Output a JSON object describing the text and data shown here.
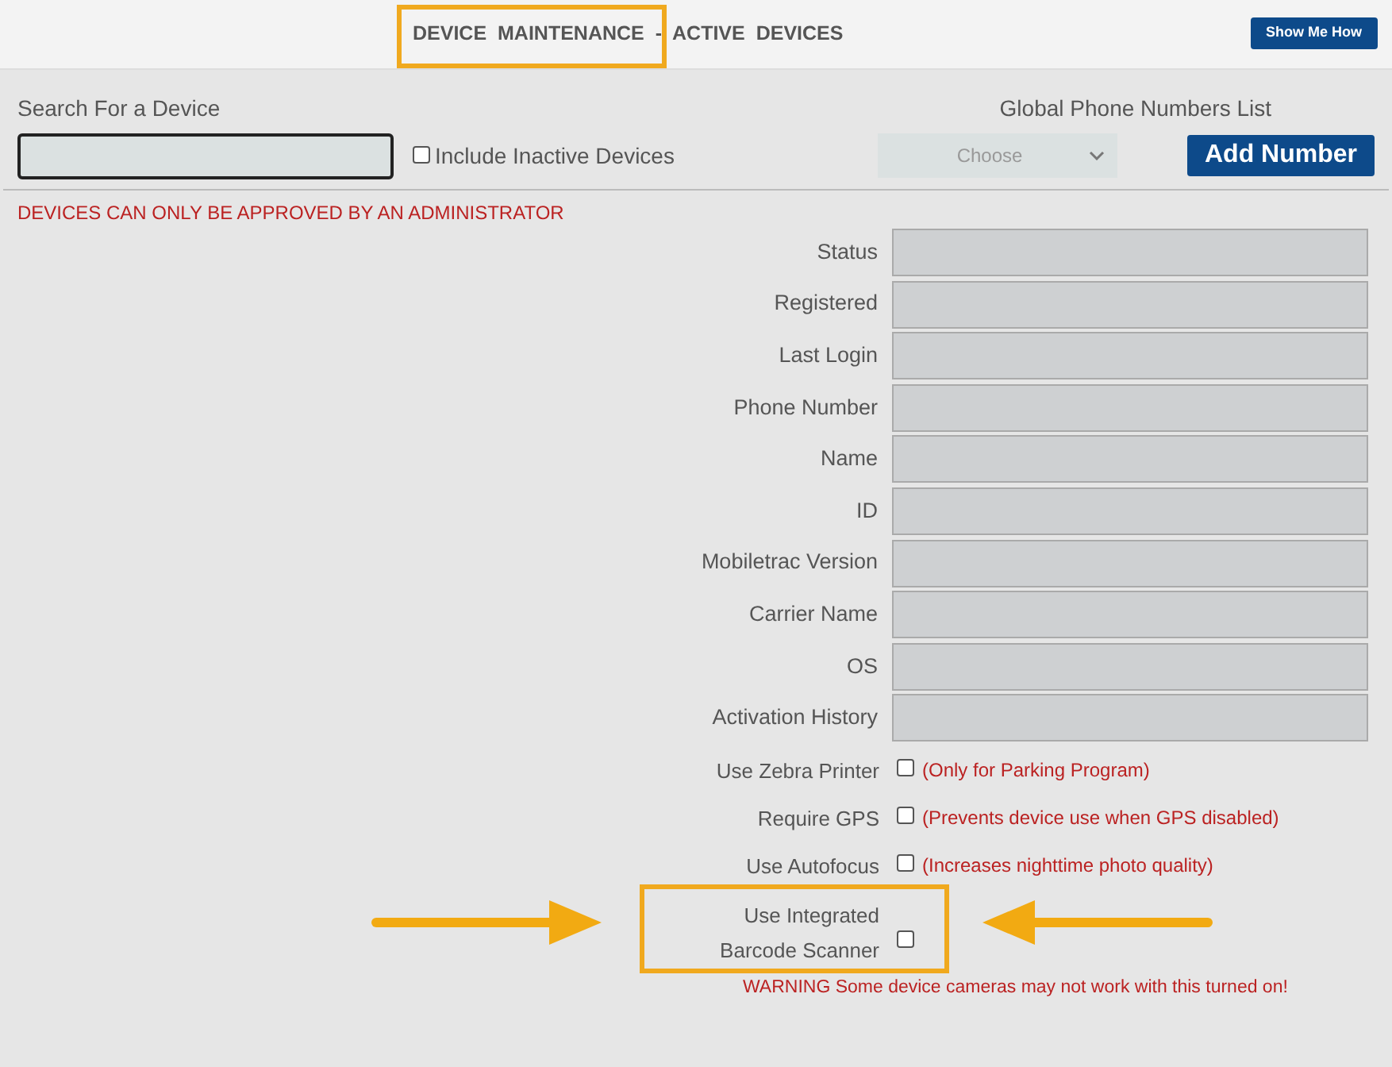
{
  "header": {
    "title": "DEVICE MAINTENANCE - ACTIVE DEVICES",
    "help_button": "Show Me How"
  },
  "search": {
    "label": "Search For a Device",
    "include_inactive": {
      "label": "Include Inactive Devices",
      "checked": false
    }
  },
  "global_phone": {
    "label": "Global Phone Numbers List",
    "select": "Choose",
    "add_button": "Add Number"
  },
  "notice": "DEVICES CAN ONLY BE APPROVED BY AN ADMINISTRATOR",
  "fields": [
    "Status",
    "Registered",
    "Last Login",
    "Phone Number",
    "Name",
    "ID",
    "Mobiletrac Version",
    "Carrier Name",
    "OS",
    "Activation History"
  ],
  "options": [
    {
      "kind": "inline",
      "label": "Use Zebra Printer",
      "checked": false,
      "note": "(Only for Parking Program)"
    },
    {
      "kind": "inline",
      "label": "Require GPS",
      "checked": false,
      "note": "(Prevents device use when GPS disabled)"
    },
    {
      "kind": "inline",
      "label": "Use Autofocus",
      "checked": false,
      "note": "(Increases nighttime photo quality)"
    },
    {
      "kind": "stacked",
      "label": "Use Integrated Barcode Scanner",
      "checked": false,
      "warning": "WARNING Some device cameras may not work with this turned on!"
    }
  ]
}
